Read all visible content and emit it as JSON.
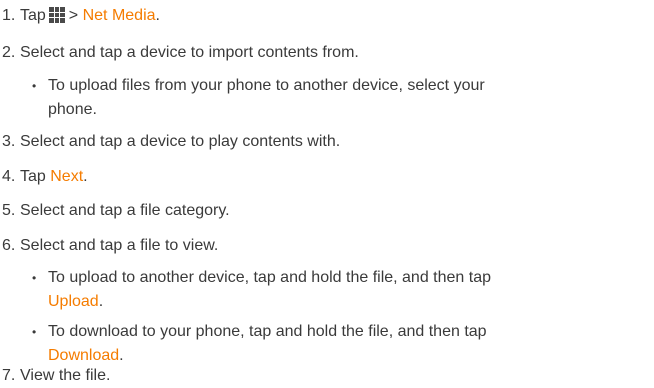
{
  "steps": {
    "s1": {
      "num": "1.",
      "pre": "Tap",
      "sep": ">",
      "highlight": "Net Media",
      "post": ".",
      "icon": "apps-grid-icon"
    },
    "s2": {
      "num": "2.",
      "text": "Select and tap a device to import contents from."
    },
    "s2_bullet": {
      "line1": "To upload files from your phone to another device, select your",
      "line2": "phone."
    },
    "s3": {
      "num": "3.",
      "text": "Select and tap a device to play contents with."
    },
    "s4": {
      "num": "4.",
      "pre": "Tap",
      "highlight": "Next",
      "post": "."
    },
    "s5": {
      "num": "5.",
      "text": "Select and tap a file category."
    },
    "s6": {
      "num": "6.",
      "text": "Select and tap a file to view."
    },
    "s6_bullet1": {
      "line1": "To upload to another device, tap and hold the file, and then tap",
      "highlight": "Upload",
      "post": "."
    },
    "s6_bullet2": {
      "line1": "To download to your phone, tap and hold the file, and then tap",
      "highlight": "Download",
      "post": "."
    },
    "s7": {
      "num": "7.",
      "text": "View the file."
    }
  },
  "colors": {
    "highlight": "#f57c00",
    "text": "#3a3a3a"
  }
}
